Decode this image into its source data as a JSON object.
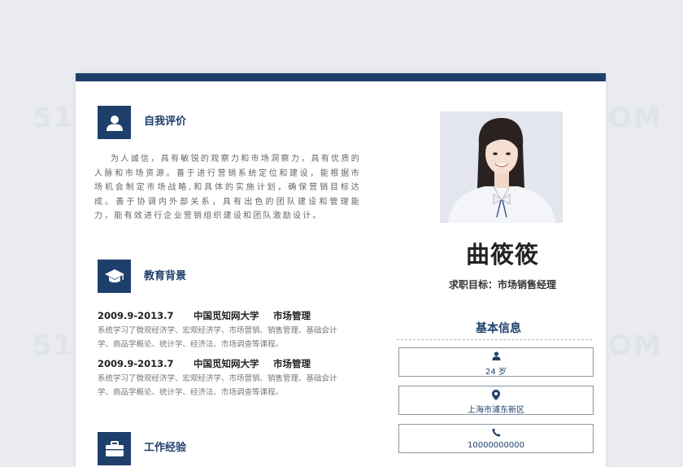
{
  "sections": {
    "self_eval": {
      "title": "自我评价"
    },
    "education": {
      "title": "教育背景"
    },
    "work": {
      "title": "工作经验"
    }
  },
  "self_eval_text": "为人诚信，具有敏锐的观察力和市场洞察力，具有优质的人脉和市场资源。善于进行营销系统定位和建设，能根据市场机会制定市场战略,和具体的实施计划，确保营销目标达成。善于协调内外部关系，具有出色的团队建设和管理能力，能有效进行企业营销组织建设和团队激励设计。",
  "education": [
    {
      "period": "2009.9-2013.7",
      "school": "中国觅知网大学",
      "major": "市场管理",
      "desc": "系统学习了微观经济学、宏观经济学、市场营销、销售管理、基础会计学、商品学概论、统计学、经济法、市场调查等课程。"
    },
    {
      "period": "2009.9-2013.7",
      "school": "中国觅知网大学",
      "major": "市场管理",
      "desc": "系统学习了微观经济学、宏观经济学、市场营销、销售管理、基础会计学、商品学概论、统计学、经济法、市场调查等课程。"
    }
  ],
  "profile": {
    "name": "曲筱筱",
    "goal": "求职目标：市场销售经理"
  },
  "basic_info": {
    "title": "基本信息",
    "age": "24 岁",
    "location": "上海市浦东新区",
    "phone": "10000000000"
  },
  "colors": {
    "accent": "#1e3f6b"
  },
  "icons": {
    "self_eval": "user-icon",
    "education": "graduation-cap-icon",
    "work": "briefcase-icon",
    "age": "user-icon",
    "location": "location-pin-icon",
    "phone": "phone-icon"
  }
}
